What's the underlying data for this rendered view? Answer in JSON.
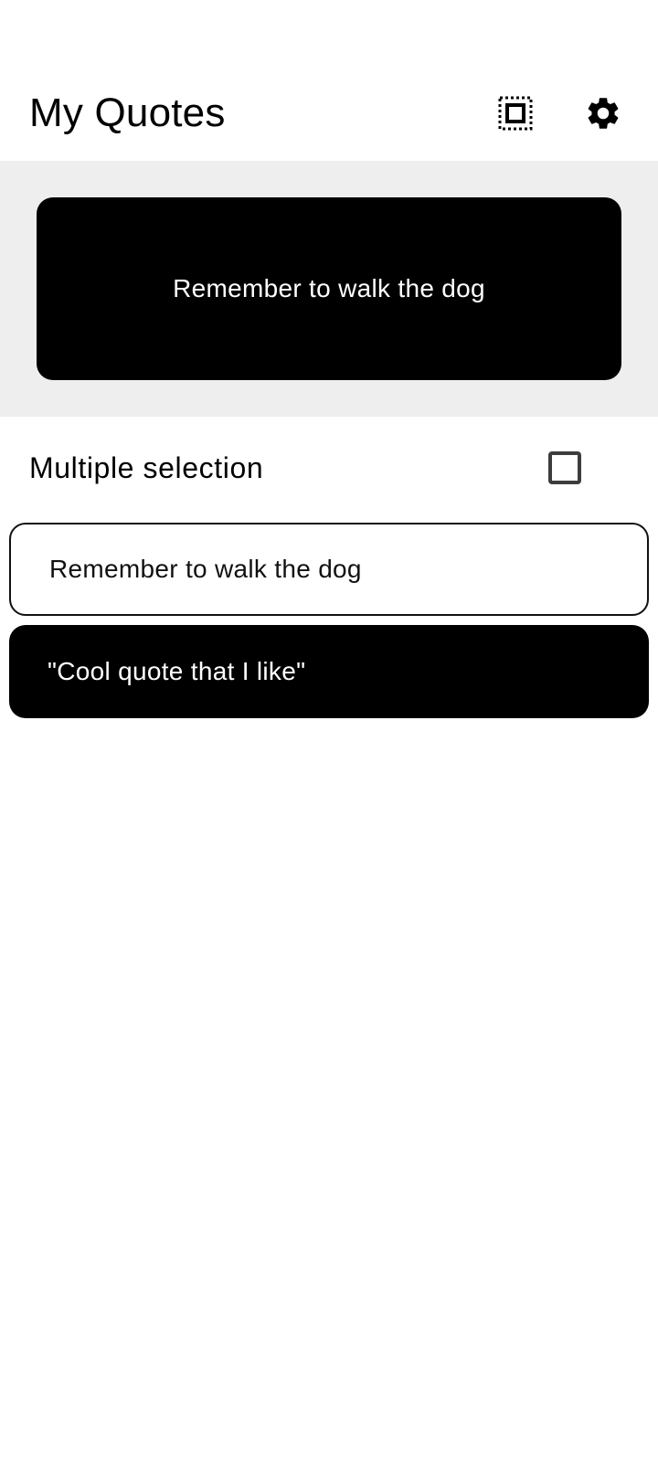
{
  "app_bar": {
    "title": "My Quotes",
    "actions": [
      {
        "icon": "select-all-icon"
      },
      {
        "icon": "settings-gear-icon"
      }
    ]
  },
  "preview": {
    "text": "Remember to walk the dog",
    "background": "#000000",
    "text_color": "#ffffff"
  },
  "multi_select": {
    "label": "Multiple selection",
    "checked": false
  },
  "quotes": [
    {
      "text": "Remember to walk the dog",
      "style": "outlined"
    },
    {
      "text": "\"Cool quote that I like\"",
      "style": "filled"
    }
  ],
  "colors": {
    "preview_section_bg": "#eeeeee",
    "accent": "#000000"
  }
}
